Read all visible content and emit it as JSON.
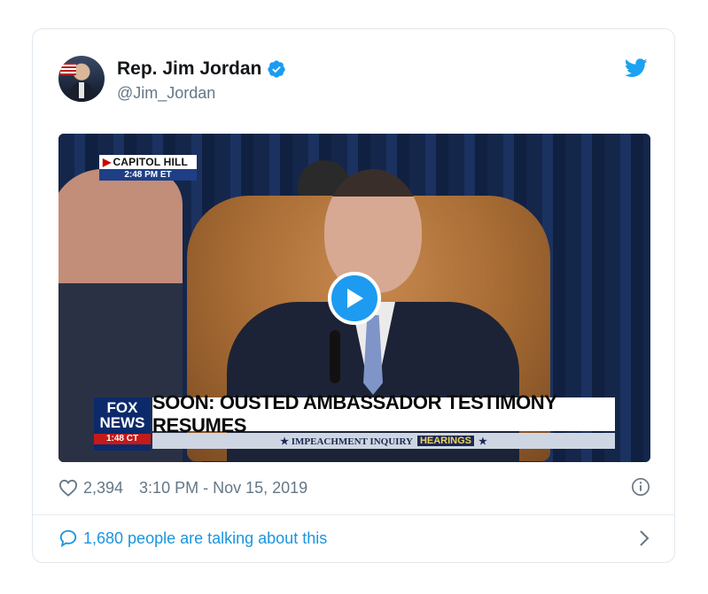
{
  "tweet": {
    "display_name": "Rep. Jim Jordan",
    "handle": "@Jim_Jordan",
    "icons": {
      "verified": "verified-badge-icon",
      "brand": "twitter-bird-icon",
      "like": "heart-icon",
      "info": "info-icon",
      "reply": "speech-bubble-icon",
      "more": "chevron-right-icon",
      "play": "play-icon"
    },
    "colors": {
      "accent": "#1d9bf0",
      "link": "#1b95e0",
      "muted": "#657786"
    }
  },
  "video": {
    "location_label": "CAPITOL HILL",
    "location_time": "2:48 PM ET",
    "network_line1": "FOX",
    "network_line2": "NEWS",
    "network_time": "1:48 CT",
    "headline": "SOON: OUSTED AMBASSADOR TESTIMONY RESUMES",
    "subline": "★ IMPEACHMENT INQUIRY",
    "subline_highlight": "HEARINGS",
    "subline_end": "★"
  },
  "meta": {
    "likes": "2,394",
    "timestamp": "3:10 PM - Nov 15, 2019"
  },
  "footer": {
    "talking_text": "1,680 people are talking about this"
  }
}
